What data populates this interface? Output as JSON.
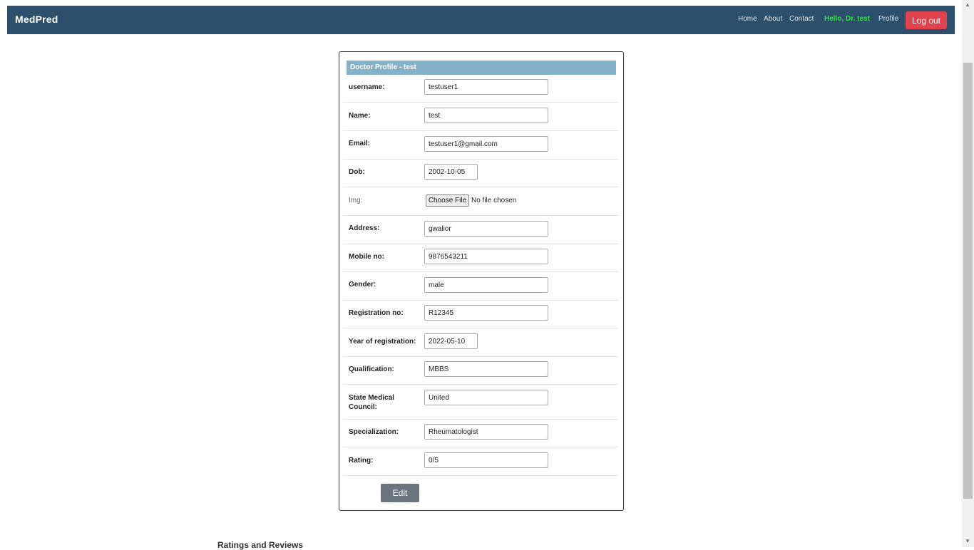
{
  "navbar": {
    "brand": "MedPred",
    "links": [
      "Home",
      "About",
      "Contact"
    ],
    "greeting": "Hello, Dr. test",
    "profile": "Profile",
    "logout": "Log out"
  },
  "profile_card": {
    "header": "Doctor Profile - test",
    "fields": [
      {
        "label": "username:",
        "value": "testuser1"
      },
      {
        "label": "Name:",
        "value": "test"
      },
      {
        "label": "Email:",
        "value": "testuser1@gmail.com"
      },
      {
        "label": "Dob:",
        "value": "2002-10-05"
      },
      {
        "label": "Img:",
        "button": "Choose File",
        "status": "No file chosen"
      },
      {
        "label": "Address:",
        "value": "gwalior"
      },
      {
        "label": "Mobile no:",
        "value": "9876543211"
      },
      {
        "label": "Gender:",
        "value": "male"
      },
      {
        "label": "Registration no:",
        "value": "R12345"
      },
      {
        "label": "Year of registration:",
        "value": "2022-05-10"
      },
      {
        "label": "Qualification:",
        "value": "MBBS"
      },
      {
        "label": "State Medical Council:",
        "value": "United"
      },
      {
        "label": "Specialization:",
        "value": "Rheumatologist"
      },
      {
        "label": "Rating:",
        "value": "0/5"
      }
    ],
    "edit_button": "Edit"
  },
  "reviews": {
    "heading": "Ratings and Reviews"
  }
}
